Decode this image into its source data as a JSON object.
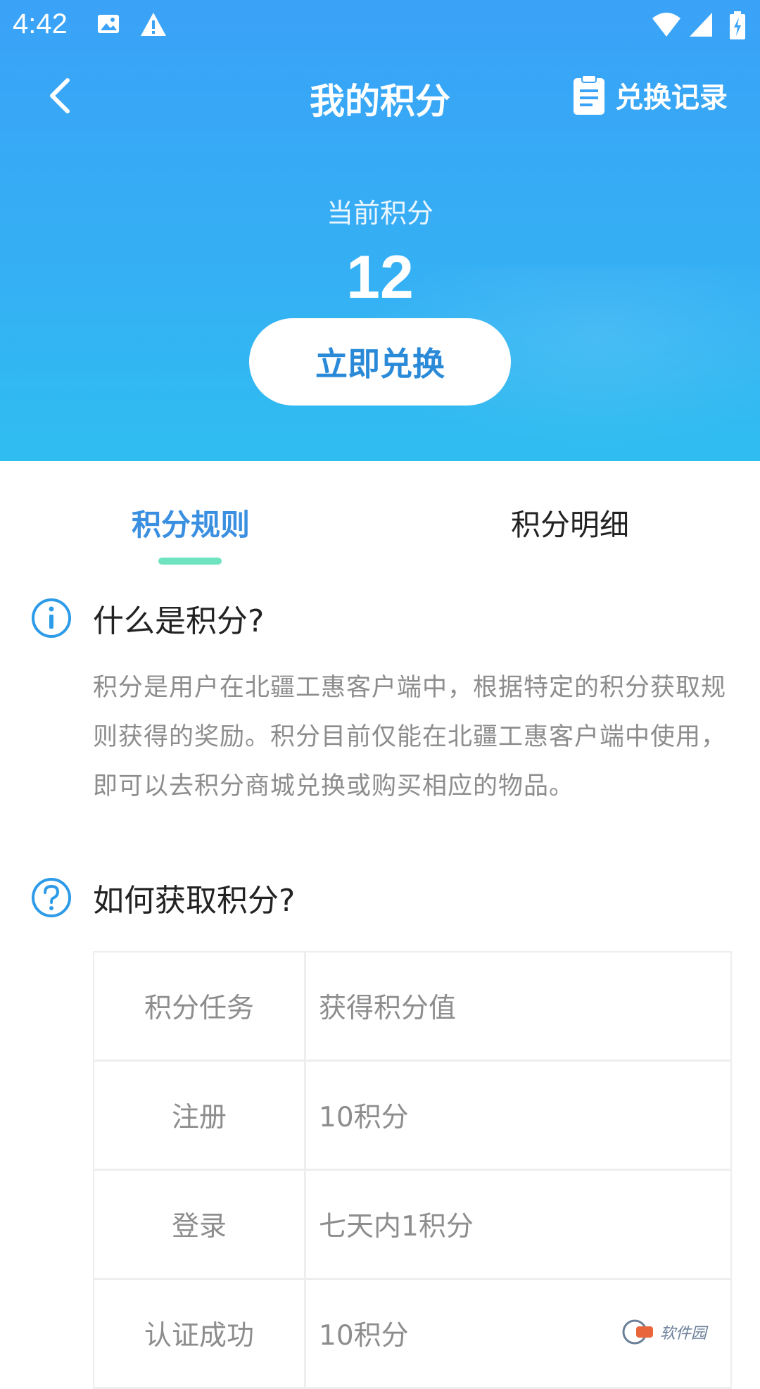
{
  "status_bar": {
    "time": "4:42",
    "icons": [
      "image-icon",
      "warning-icon",
      "wifi-icon",
      "signal-icon",
      "battery-icon"
    ]
  },
  "topbar": {
    "title": "我的积分",
    "record_label": "兑换记录"
  },
  "points": {
    "label": "当前积分",
    "value": "12",
    "redeem_label": "立即兑换"
  },
  "tabs": [
    {
      "label": "积分规则",
      "active": true
    },
    {
      "label": "积分明细",
      "active": false
    }
  ],
  "sections": {
    "what": {
      "title": "什么是积分?",
      "body": "积分是用户在北疆工惠客户端中，根据特定的积分获取规则获得的奖励。积分目前仅能在北疆工惠客户端中使用，即可以去积分商城兑换或购买相应的物品。"
    },
    "how": {
      "title": "如何获取积分?"
    }
  },
  "table": {
    "header": {
      "task": "积分任务",
      "value": "获得积分值"
    },
    "rows": [
      {
        "task": "注册",
        "value": "10积分"
      },
      {
        "task": "登录",
        "value": "七天内1积分"
      },
      {
        "task": "认证成功",
        "value": "10积分"
      }
    ]
  },
  "colors": {
    "header_gradient_top": "#3aa2f7",
    "header_gradient_bottom": "#2fbdf0",
    "accent": "#3a8fe0",
    "tab_indicator": "#6fe3c0",
    "body_text": "#8d8d8d"
  },
  "watermark": {
    "text": "软件园"
  }
}
